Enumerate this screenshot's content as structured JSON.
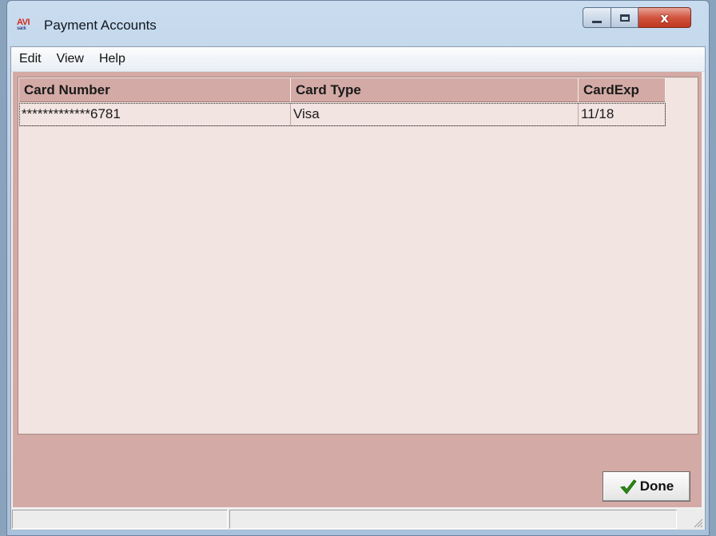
{
  "window": {
    "title": "Payment Accounts",
    "app_icon_text": "AVI",
    "app_icon_subtext": "sack",
    "close_glyph": "x"
  },
  "menu": {
    "items": [
      "Edit",
      "View",
      "Help"
    ]
  },
  "table": {
    "columns": [
      "Card Number",
      "Card Type",
      "CardExp"
    ],
    "rows": [
      [
        "*************6781",
        "Visa",
        "11/18"
      ]
    ]
  },
  "buttons": {
    "done_label": "Done"
  },
  "icons": {
    "done": "checkmark-icon",
    "grip": "resize-grip-icon"
  },
  "colors": {
    "panel": "#d3aaa5",
    "grid_background": "#f1e4e1",
    "check": "#2a8a14",
    "close_button": "#c8442f"
  }
}
